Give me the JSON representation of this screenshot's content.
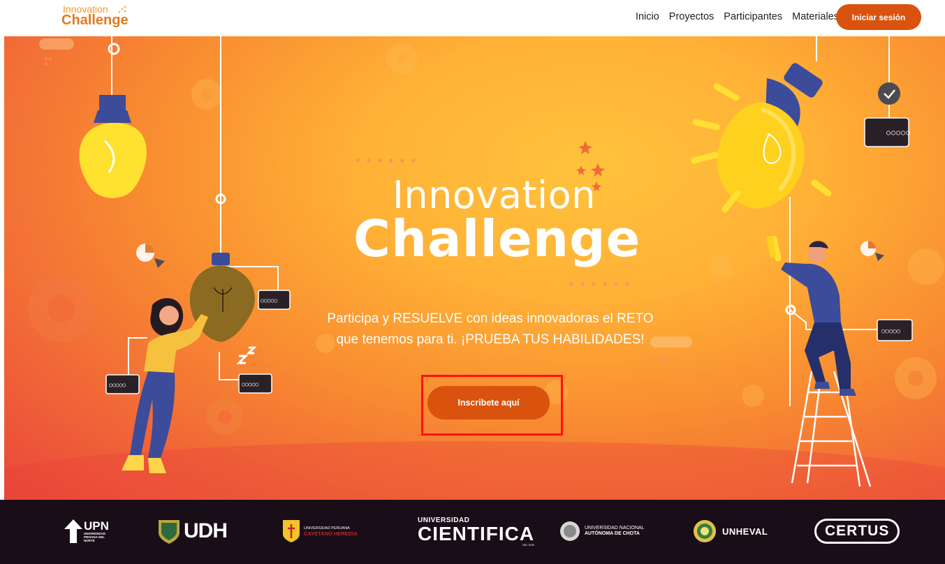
{
  "navbar": {
    "logo_top": "Innovation",
    "logo_bottom": "Challenge",
    "links": [
      "Inicio",
      "Proyectos",
      "Participantes",
      "Materiales"
    ],
    "login_label": "Iniciar sesión"
  },
  "hero": {
    "title_line1": "Innovation",
    "title_line2": "Challenge",
    "tagline": "Participa y RESUELVE con ideas innovadoras el RETO que tenemos para ti. ¡PRUEBA TUS HABILIDADES!",
    "cta_label": "Inscribete aquí",
    "panel_dots": "○○○○○"
  },
  "sponsors": {
    "upn": {
      "name": "UPN",
      "sub": "UNIVERSIDAD PRIVADA DEL NORTE"
    },
    "udh": {
      "name": "UDH"
    },
    "uch": {
      "line1": "UNIVERSIDAD PERUANA",
      "line2": "CAYETANO HEREDIA"
    },
    "cientifica": {
      "line1": "UNIVERSIDAD",
      "line2": "CIENTIFICA",
      "line3": "DEL SUR"
    },
    "unac": {
      "line1": "UNIVERSIDAD NACIONAL",
      "line2": "AUTÓNOMA DE CHOTA"
    },
    "unheval": {
      "name": "UNHEVAL"
    },
    "certus": {
      "name": "CERTUS"
    }
  },
  "colors": {
    "accent": "#d9530f",
    "logo_orange": "#f09a2a",
    "footer_bg": "#190d17",
    "highlight_outline": "#ff1111"
  }
}
